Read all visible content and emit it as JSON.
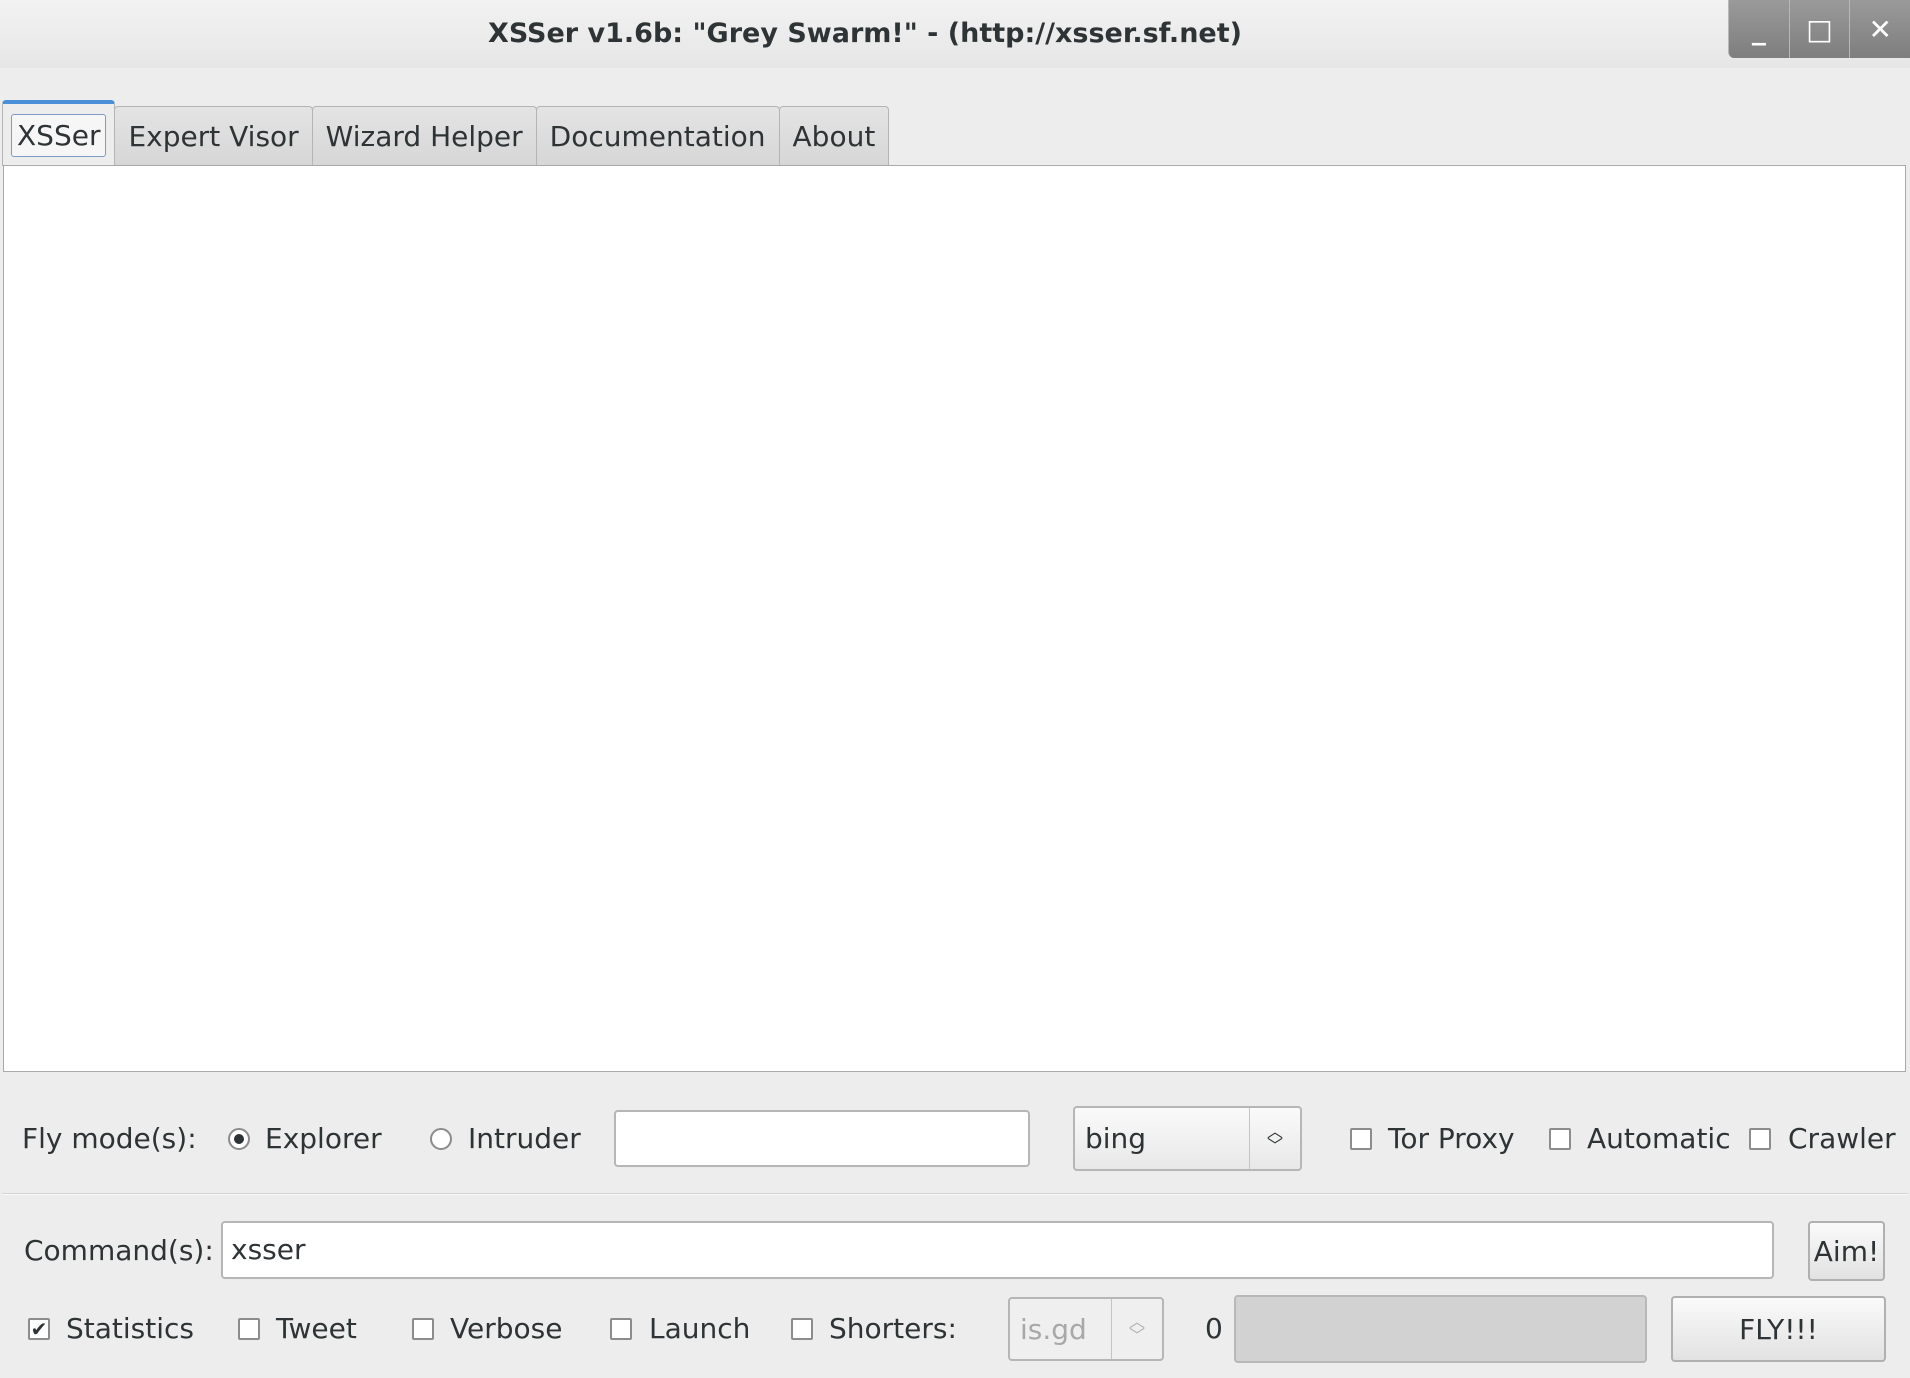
{
  "window": {
    "title": "XSSer v1.6b: \"Grey Swarm!\" - (http://xsser.sf.net)",
    "minimize_glyph": "_",
    "maximize_glyph": "□",
    "close_glyph": "✕"
  },
  "tabs": [
    {
      "label": "XSSer",
      "active": true
    },
    {
      "label": "Expert Visor",
      "active": false
    },
    {
      "label": "Wizard Helper",
      "active": false
    },
    {
      "label": "Documentation",
      "active": false
    },
    {
      "label": "About",
      "active": false
    }
  ],
  "fly_mode": {
    "label": "Fly mode(s):",
    "explorer_label": "Explorer",
    "explorer_selected": true,
    "intruder_label": "Intruder",
    "intruder_selected": false,
    "dork_input_value": "",
    "engine_selected": "bing",
    "tor_proxy_label": "Tor Proxy",
    "tor_proxy_checked": false,
    "automatic_label": "Automatic",
    "automatic_checked": false,
    "crawler_label": "Crawler",
    "crawler_checked": false
  },
  "command": {
    "label": "Command(s):",
    "value": "xsser",
    "aim_label": "Aim!"
  },
  "options": {
    "statistics_label": "Statistics",
    "statistics_checked": true,
    "tweet_label": "Tweet",
    "tweet_checked": false,
    "verbose_label": "Verbose",
    "verbose_checked": false,
    "launch_label": "Launch",
    "launch_checked": false,
    "shorters_label": "Shorters:",
    "shorters_checked": false,
    "shortener_selected": "is.gd",
    "progress_count": "0",
    "progress_value": 0,
    "fly_label": "FLY!!!"
  },
  "colors": {
    "accent": "#4a90d9",
    "window_bg": "#ededed",
    "pane_bg": "#ffffff"
  }
}
